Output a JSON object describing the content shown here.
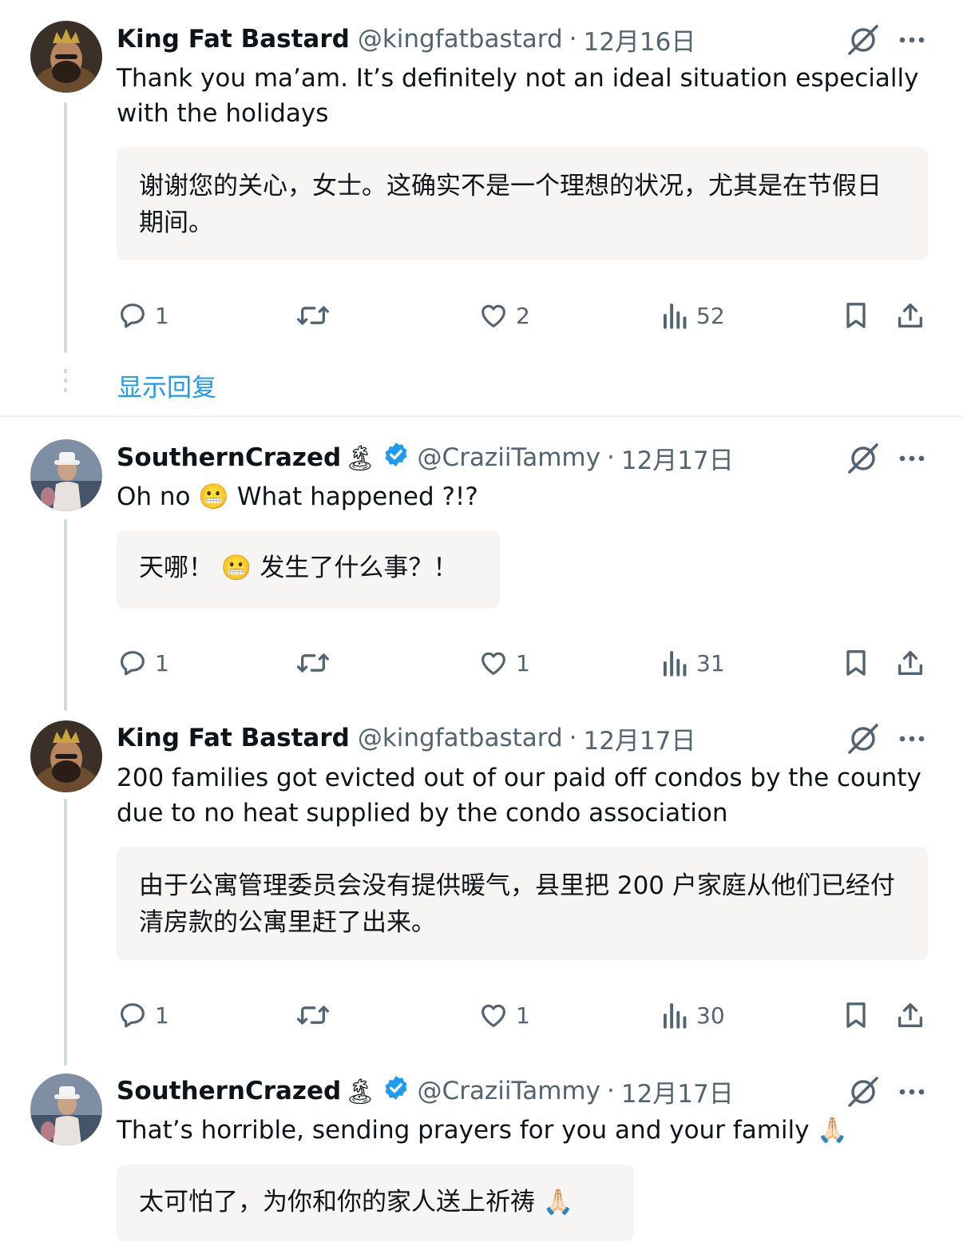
{
  "tweets": [
    {
      "name": "King Fat Bastard",
      "handle": "@kingfatbastard",
      "date": "12月16日",
      "text": "Thank you ma’am. It’s definitely not an ideal situation especially with the holidays",
      "translation": "谢谢您的关心，女士。这确实不是一个理想的状况，尤其是在节假日期间。",
      "replies": "1",
      "retweets": "",
      "likes": "2",
      "views": "52",
      "verified": false
    },
    {
      "name": "SouthernCrazed",
      "name_emoji": "🏝",
      "handle": "@CraziiTammy",
      "date": "12月17日",
      "text_before": "Oh no",
      "text_emoji": "😬",
      "text_after": "What happened ?!?",
      "translation_before": "天哪！",
      "translation_emoji": "😬",
      "translation_after": "发生了什么事？！",
      "replies": "1",
      "retweets": "",
      "likes": "1",
      "views": "31",
      "verified": true
    },
    {
      "name": "King Fat Bastard",
      "handle": "@kingfatbastard",
      "date": "12月17日",
      "text": "200 families got evicted out of our paid off condos by the county due to no heat supplied by the condo association",
      "translation": "由于公寓管理委员会没有提供暖气，县里把 200 户家庭从他们已经付清房款的公寓里赶了出来。",
      "replies": "1",
      "retweets": "",
      "likes": "1",
      "views": "30",
      "verified": false
    },
    {
      "name": "SouthernCrazed",
      "name_emoji": "🏝",
      "handle": "@CraziiTammy",
      "date": "12月17日",
      "text": "That’s horrible, sending prayers for you and your family",
      "text_emoji": "🙏🏻",
      "translation": "太可怕了，为你和你的家人送上祈祷",
      "translation_emoji": "🙏🏻",
      "verified": true
    }
  ],
  "show_replies": "显示回复",
  "sep": "·",
  "colors": {
    "accent": "#1d9bf0",
    "muted": "#536471",
    "translation_bg": "#f7f4f4",
    "thread_line": "#cfd9de"
  },
  "icons": [
    "grok-icon",
    "more-icon",
    "reply-icon",
    "retweet-icon",
    "like-icon",
    "views-icon",
    "bookmark-icon",
    "share-icon",
    "verified-badge-icon"
  ]
}
